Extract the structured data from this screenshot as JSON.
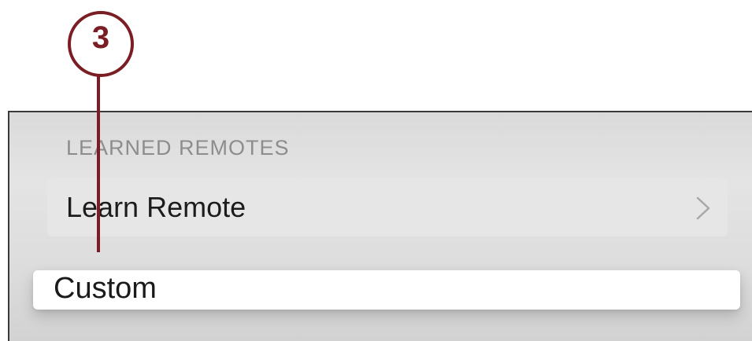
{
  "callout": {
    "number": "3",
    "color": "#7a1e24"
  },
  "settings": {
    "section_header": "LEARNED REMOTES",
    "rows": [
      {
        "label": "Learn Remote",
        "icon": "chevron-right-icon"
      },
      {
        "label": "Custom",
        "selected": true
      }
    ]
  },
  "colors": {
    "background": "#dcdcdc",
    "selected_row": "#ffffff",
    "header_text": "#8d8d8d"
  }
}
